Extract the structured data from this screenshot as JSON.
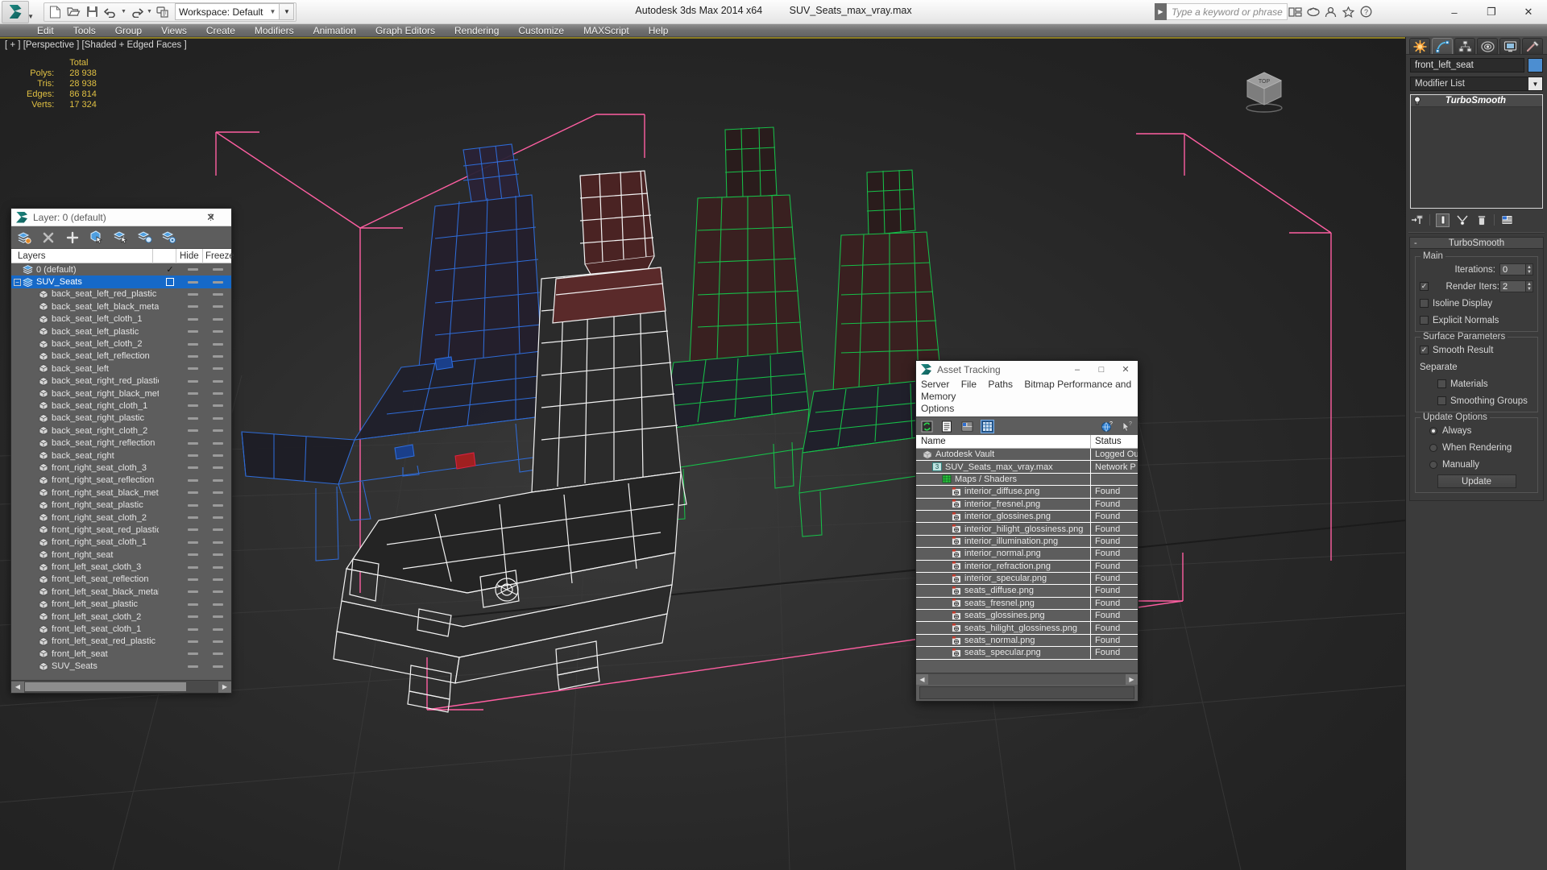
{
  "titlebar": {
    "app_title": "Autodesk 3ds Max  2014 x64",
    "file_name": "SUV_Seats_max_vray.max",
    "workspace_label": "Workspace: Default",
    "search_placeholder": "Type a keyword or phrase",
    "minimize": "–",
    "maximize": "❐",
    "close": "✕"
  },
  "menu": {
    "items": [
      "Edit",
      "Tools",
      "Group",
      "Views",
      "Create",
      "Modifiers",
      "Animation",
      "Graph Editors",
      "Rendering",
      "Customize",
      "MAXScript",
      "Help"
    ]
  },
  "viewport": {
    "label": "[ + ] [Perspective ] [Shaded + Edged Faces ]",
    "stats_header": "Total",
    "stats": [
      {
        "label": "Polys:",
        "value": "28 938"
      },
      {
        "label": "Tris:",
        "value": "28 938"
      },
      {
        "label": "Edges:",
        "value": "86 814"
      },
      {
        "label": "Verts:",
        "value": "17 324"
      }
    ],
    "viewcube_label": "TOP"
  },
  "layer_dialog": {
    "title": "Layer: 0 (default)",
    "help_glyph": "?",
    "close_glyph": "✕",
    "columns": {
      "layers": "Layers",
      "hide": "Hide",
      "freeze": "Freeze"
    },
    "toolbar": [
      "new-layer-icon",
      "delete-layer-icon",
      "add-layer-icon",
      "select-objects-icon",
      "select-highlighted-icon",
      "add-selection-icon",
      "layer-properties-icon"
    ],
    "rows": [
      {
        "name": "0 (default)",
        "indent": 1,
        "icon": "layer-icon",
        "selected": false,
        "current": true,
        "expander": false
      },
      {
        "name": "SUV_Seats",
        "indent": 0,
        "icon": "layer-icon",
        "selected": true,
        "current": false,
        "expander": true
      },
      {
        "name": "back_seat_left_red_plastic",
        "indent": 2,
        "icon": "object-icon",
        "selected": false,
        "current": false,
        "expander": false
      },
      {
        "name": "back_seat_left_black_metal",
        "indent": 2,
        "icon": "object-icon",
        "selected": false,
        "current": false,
        "expander": false
      },
      {
        "name": "back_seat_left_cloth_1",
        "indent": 2,
        "icon": "object-icon",
        "selected": false,
        "current": false,
        "expander": false
      },
      {
        "name": "back_seat_left_plastic",
        "indent": 2,
        "icon": "object-icon",
        "selected": false,
        "current": false,
        "expander": false
      },
      {
        "name": "back_seat_left_cloth_2",
        "indent": 2,
        "icon": "object-icon",
        "selected": false,
        "current": false,
        "expander": false
      },
      {
        "name": "back_seat_left_reflection",
        "indent": 2,
        "icon": "object-icon",
        "selected": false,
        "current": false,
        "expander": false
      },
      {
        "name": "back_seat_left",
        "indent": 2,
        "icon": "object-icon",
        "selected": false,
        "current": false,
        "expander": false
      },
      {
        "name": "back_seat_right_red_plastic",
        "indent": 2,
        "icon": "object-icon",
        "selected": false,
        "current": false,
        "expander": false
      },
      {
        "name": "back_seat_right_black_metal",
        "indent": 2,
        "icon": "object-icon",
        "selected": false,
        "current": false,
        "expander": false
      },
      {
        "name": "back_seat_right_cloth_1",
        "indent": 2,
        "icon": "object-icon",
        "selected": false,
        "current": false,
        "expander": false
      },
      {
        "name": "back_seat_right_plastic",
        "indent": 2,
        "icon": "object-icon",
        "selected": false,
        "current": false,
        "expander": false
      },
      {
        "name": "back_seat_right_cloth_2",
        "indent": 2,
        "icon": "object-icon",
        "selected": false,
        "current": false,
        "expander": false
      },
      {
        "name": "back_seat_right_reflection",
        "indent": 2,
        "icon": "object-icon",
        "selected": false,
        "current": false,
        "expander": false
      },
      {
        "name": "back_seat_right",
        "indent": 2,
        "icon": "object-icon",
        "selected": false,
        "current": false,
        "expander": false
      },
      {
        "name": "front_right_seat_cloth_3",
        "indent": 2,
        "icon": "object-icon",
        "selected": false,
        "current": false,
        "expander": false
      },
      {
        "name": "front_right_seat_reflection",
        "indent": 2,
        "icon": "object-icon",
        "selected": false,
        "current": false,
        "expander": false
      },
      {
        "name": "front_right_seat_black_metal",
        "indent": 2,
        "icon": "object-icon",
        "selected": false,
        "current": false,
        "expander": false
      },
      {
        "name": "front_right_seat_plastic",
        "indent": 2,
        "icon": "object-icon",
        "selected": false,
        "current": false,
        "expander": false
      },
      {
        "name": "front_right_seat_cloth_2",
        "indent": 2,
        "icon": "object-icon",
        "selected": false,
        "current": false,
        "expander": false
      },
      {
        "name": "front_right_seat_red_plastic",
        "indent": 2,
        "icon": "object-icon",
        "selected": false,
        "current": false,
        "expander": false
      },
      {
        "name": "front_right_seat_cloth_1",
        "indent": 2,
        "icon": "object-icon",
        "selected": false,
        "current": false,
        "expander": false
      },
      {
        "name": "front_right_seat",
        "indent": 2,
        "icon": "object-icon",
        "selected": false,
        "current": false,
        "expander": false
      },
      {
        "name": "front_left_seat_cloth_3",
        "indent": 2,
        "icon": "object-icon",
        "selected": false,
        "current": false,
        "expander": false
      },
      {
        "name": "front_left_seat_reflection",
        "indent": 2,
        "icon": "object-icon",
        "selected": false,
        "current": false,
        "expander": false
      },
      {
        "name": "front_left_seat_black_metal",
        "indent": 2,
        "icon": "object-icon",
        "selected": false,
        "current": false,
        "expander": false
      },
      {
        "name": "front_left_seat_plastic",
        "indent": 2,
        "icon": "object-icon",
        "selected": false,
        "current": false,
        "expander": false
      },
      {
        "name": "front_left_seat_cloth_2",
        "indent": 2,
        "icon": "object-icon",
        "selected": false,
        "current": false,
        "expander": false
      },
      {
        "name": "front_left_seat_cloth_1",
        "indent": 2,
        "icon": "object-icon",
        "selected": false,
        "current": false,
        "expander": false
      },
      {
        "name": "front_left_seat_red_plastic",
        "indent": 2,
        "icon": "object-icon",
        "selected": false,
        "current": false,
        "expander": false
      },
      {
        "name": "front_left_seat",
        "indent": 2,
        "icon": "object-icon",
        "selected": false,
        "current": false,
        "expander": false
      },
      {
        "name": "SUV_Seats",
        "indent": 2,
        "icon": "object-icon",
        "selected": false,
        "current": false,
        "expander": false
      }
    ]
  },
  "asset_tracking": {
    "title": "Asset Tracking",
    "minimize": "–",
    "maximize": "□",
    "close": "✕",
    "menu": [
      "Server",
      "File",
      "Paths",
      "Bitmap Performance and Memory",
      "Options"
    ],
    "columns": {
      "name": "Name",
      "status": "Status"
    },
    "toolbar": [
      "refresh-icon",
      "list-view-icon",
      "detail-view-icon",
      "grid-view-icon",
      "help-globe-icon",
      "help-arrow-icon"
    ],
    "rows": [
      {
        "name": "Autodesk Vault",
        "status": "Logged Ou",
        "indent": 1,
        "icon": "vault-icon"
      },
      {
        "name": "SUV_Seats_max_vray.max",
        "status": "Network P",
        "indent": 2,
        "icon": "max-file-icon"
      },
      {
        "name": "Maps / Shaders",
        "status": "",
        "indent": 3,
        "icon": "maps-shaders-icon"
      },
      {
        "name": "interior_diffuse.png",
        "status": "Found",
        "indent": 4,
        "icon": "bitmap-icon"
      },
      {
        "name": "interior_fresnel.png",
        "status": "Found",
        "indent": 4,
        "icon": "bitmap-icon"
      },
      {
        "name": "interior_glossines.png",
        "status": "Found",
        "indent": 4,
        "icon": "bitmap-icon"
      },
      {
        "name": "interior_hilight_glossiness.png",
        "status": "Found",
        "indent": 4,
        "icon": "bitmap-icon"
      },
      {
        "name": "interior_illumination.png",
        "status": "Found",
        "indent": 4,
        "icon": "bitmap-icon"
      },
      {
        "name": "interior_normal.png",
        "status": "Found",
        "indent": 4,
        "icon": "bitmap-icon"
      },
      {
        "name": "interior_refraction.png",
        "status": "Found",
        "indent": 4,
        "icon": "bitmap-icon"
      },
      {
        "name": "interior_specular.png",
        "status": "Found",
        "indent": 4,
        "icon": "bitmap-icon"
      },
      {
        "name": "seats_diffuse.png",
        "status": "Found",
        "indent": 4,
        "icon": "bitmap-icon"
      },
      {
        "name": "seats_fresnel.png",
        "status": "Found",
        "indent": 4,
        "icon": "bitmap-icon"
      },
      {
        "name": "seats_glossines.png",
        "status": "Found",
        "indent": 4,
        "icon": "bitmap-icon"
      },
      {
        "name": "seats_hilight_glossiness.png",
        "status": "Found",
        "indent": 4,
        "icon": "bitmap-icon"
      },
      {
        "name": "seats_normal.png",
        "status": "Found",
        "indent": 4,
        "icon": "bitmap-icon"
      },
      {
        "name": "seats_specular.png",
        "status": "Found",
        "indent": 4,
        "icon": "bitmap-icon"
      }
    ]
  },
  "command_panel": {
    "tabs": [
      "create-tab",
      "modify-tab",
      "hierarchy-tab",
      "motion-tab",
      "display-tab",
      "utilities-tab"
    ],
    "active_tab_index": 1,
    "object_name": "front_left_seat",
    "object_color": "#4c8ed1",
    "modifier_list_label": "Modifier List",
    "stack": [
      {
        "name": "TurboSmooth",
        "icon": "lightbulb-icon"
      }
    ],
    "stack_buttons": [
      "pin-stack-icon",
      "show-end-result-icon",
      "make-unique-icon",
      "remove-modifier-icon",
      "configure-modifier-sets-icon"
    ],
    "rollout": {
      "title": "TurboSmooth",
      "collapse_glyph": "-",
      "groups": [
        {
          "title": "Main",
          "fields": [
            {
              "type": "spinner",
              "label": "Iterations:",
              "value": "0"
            },
            {
              "type": "checkbox-spinner",
              "label": "Render Iters:",
              "value": "2",
              "checked": true
            },
            {
              "type": "checkbox",
              "label": "Isoline Display",
              "checked": false
            },
            {
              "type": "checkbox",
              "label": "Explicit Normals",
              "checked": false
            }
          ]
        },
        {
          "title": "Surface Parameters",
          "fields": [
            {
              "type": "checkbox",
              "label": "Smooth Result",
              "checked": true
            },
            {
              "type": "text",
              "label": "Separate"
            },
            {
              "type": "checkbox-indent",
              "label": "Materials",
              "checked": false
            },
            {
              "type": "checkbox-indent",
              "label": "Smoothing Groups",
              "checked": false
            }
          ]
        },
        {
          "title": "Update Options",
          "fields": [
            {
              "type": "radio",
              "label": "Always",
              "checked": true
            },
            {
              "type": "radio",
              "label": "When Rendering",
              "checked": false
            },
            {
              "type": "radio",
              "label": "Manually",
              "checked": false
            },
            {
              "type": "button",
              "label": "Update"
            }
          ]
        }
      ]
    }
  }
}
